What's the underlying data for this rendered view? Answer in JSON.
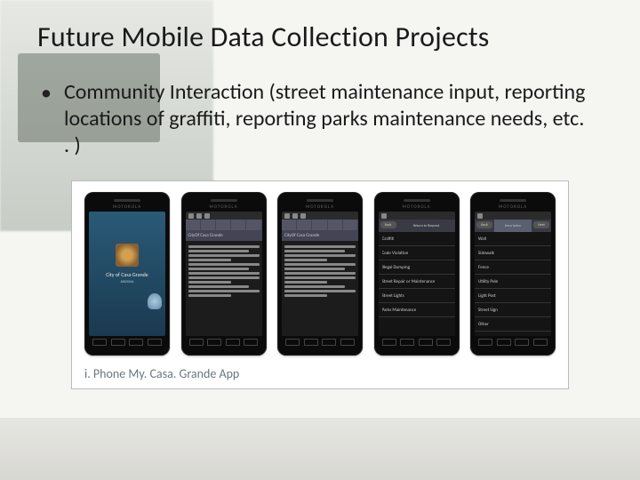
{
  "title": "Future Mobile Data Collection Projects",
  "bullet": "Community Interaction (street maintenance input, reporting locations of graffiti, reporting parks maintenance needs, etc. . )",
  "caption": "i. Phone My. Casa. Grande App",
  "phones": {
    "brand": "motorola",
    "splash": {
      "name": "City of Casa Grande",
      "sub": "ARIZONA"
    },
    "info_header": "CityOf Casa Grande",
    "categories": {
      "title": "Return to Request",
      "back": "Back",
      "items": [
        "Graffiti",
        "Code Violation",
        "Illegal Dumping",
        "Street Repair or Maintenance",
        "Street Lights",
        "Parks Maintenance"
      ]
    },
    "detail": {
      "tab": "Description",
      "back": "Back",
      "next": "Next",
      "items": [
        "Wall",
        "Sidewalk",
        "Fence",
        "Utility Pole",
        "Light Post",
        "Street Sign",
        "Other"
      ]
    }
  }
}
